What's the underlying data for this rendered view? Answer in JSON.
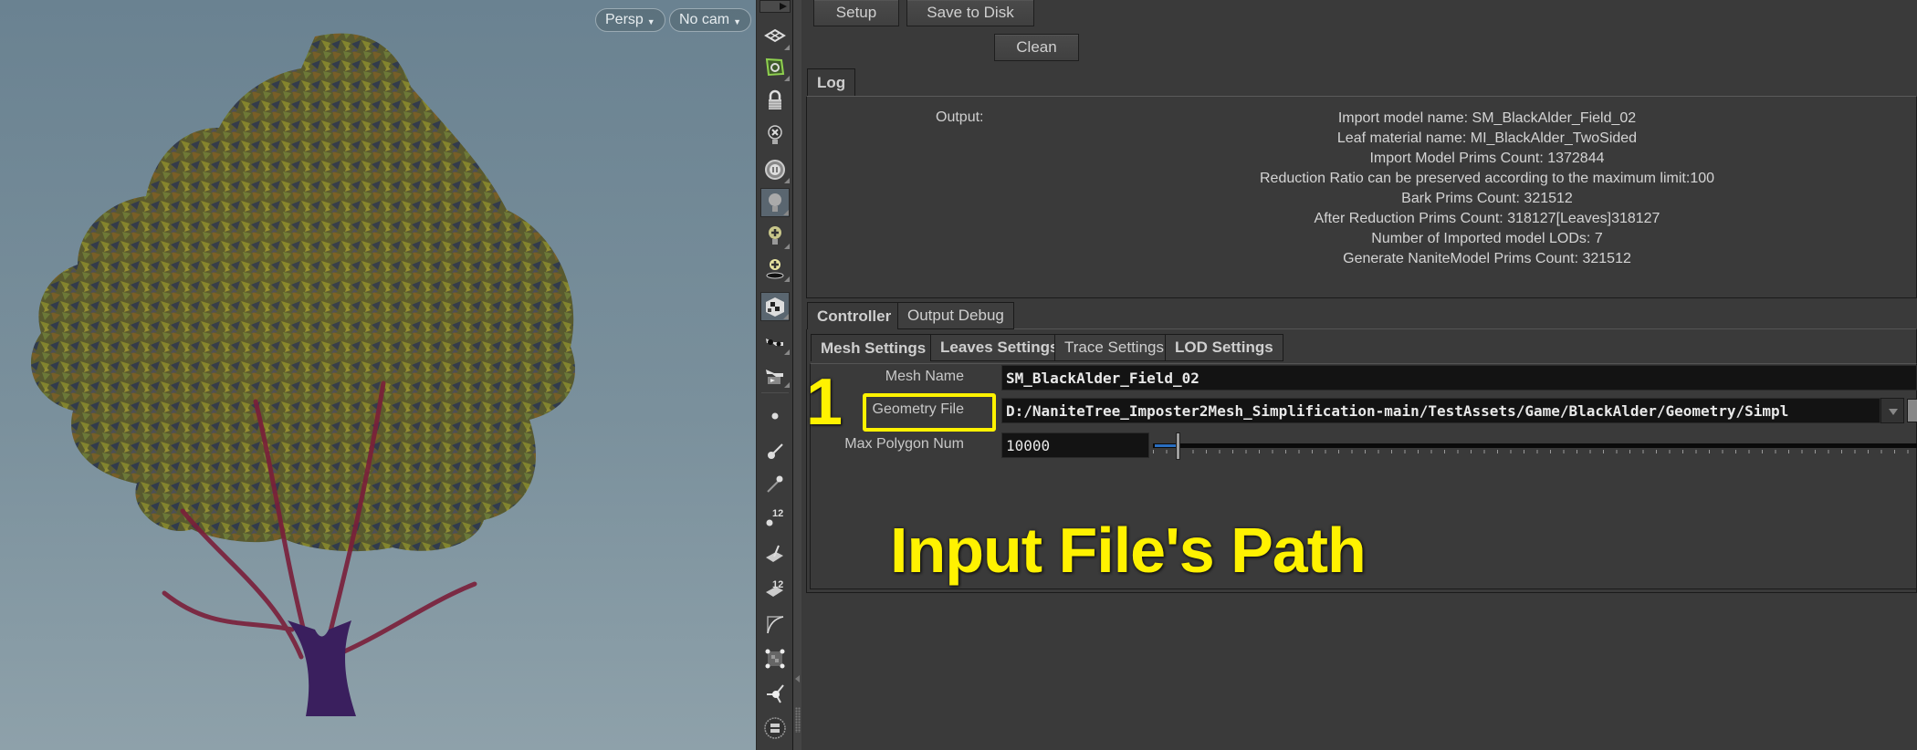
{
  "viewport": {
    "view_menu": "Persp",
    "camera_menu": "No cam"
  },
  "toolbar": {
    "icons": [
      "viewport-layout-icon",
      "snapping-icon",
      "lock-camera-icon",
      "headlight-off-icon",
      "display-options-icon",
      "normal-light-icon",
      "add-light-icon",
      "add-spot-light-icon",
      "shading-mode-icon",
      "stereo-glasses-icon",
      "stereo-render-icon",
      "point-icon",
      "point-normal-icon",
      "vertex-icon",
      "point-numbers-icon",
      "primitive-normal-icon",
      "primitive-numbers-icon",
      "curve-hull-icon",
      "prim-select-icon",
      "axis-handle-icon",
      "background-icon"
    ],
    "badges": {
      "point_numbers": "12",
      "primitive_numbers": "12"
    }
  },
  "panel": {
    "buttons": {
      "setup": "Setup",
      "save_to_disk": "Save to Disk",
      "clean": "Clean"
    },
    "log_tab": "Log",
    "log": {
      "label": "Output:",
      "lines": [
        "Import model name: SM_BlackAlder_Field_02",
        "Leaf material name: MI_BlackAlder_TwoSided",
        "Import Model Prims Count: 1372844",
        "Reduction Ratio can be preserved according to the maximum limit:100",
        "Bark Prims Count: 321512",
        "After Reduction Prims Count: 318127[Leaves]318127",
        "Number of Imported model LODs: 7",
        "Generate NaniteModel Prims Count: 321512"
      ]
    },
    "outer_tabs": [
      {
        "label": "Controller",
        "active": true
      },
      {
        "label": "Output Debug",
        "active": false
      }
    ],
    "inner_tabs": [
      {
        "label": "Mesh Settings",
        "active": true
      },
      {
        "label": "Leaves Settings",
        "active": false
      },
      {
        "label": "Trace Settings",
        "active": false
      },
      {
        "label": "LOD Settings",
        "active": false
      }
    ],
    "fields": {
      "mesh_name": {
        "label": "Mesh Name",
        "value": "SM_BlackAlder_Field_02"
      },
      "geometry_file": {
        "label": "Geometry File",
        "value": "D:/NaniteTree_Imposter2Mesh_Simplification-main/TestAssets/Game/BlackAlder/Geometry/Simpl"
      },
      "max_polygon_num": {
        "label": "Max Polygon Num",
        "value": "10000",
        "slider_fraction": 0.015
      }
    }
  },
  "annotation": {
    "step_number": "1",
    "caption": "Input File's Path",
    "color": "#fff200"
  }
}
